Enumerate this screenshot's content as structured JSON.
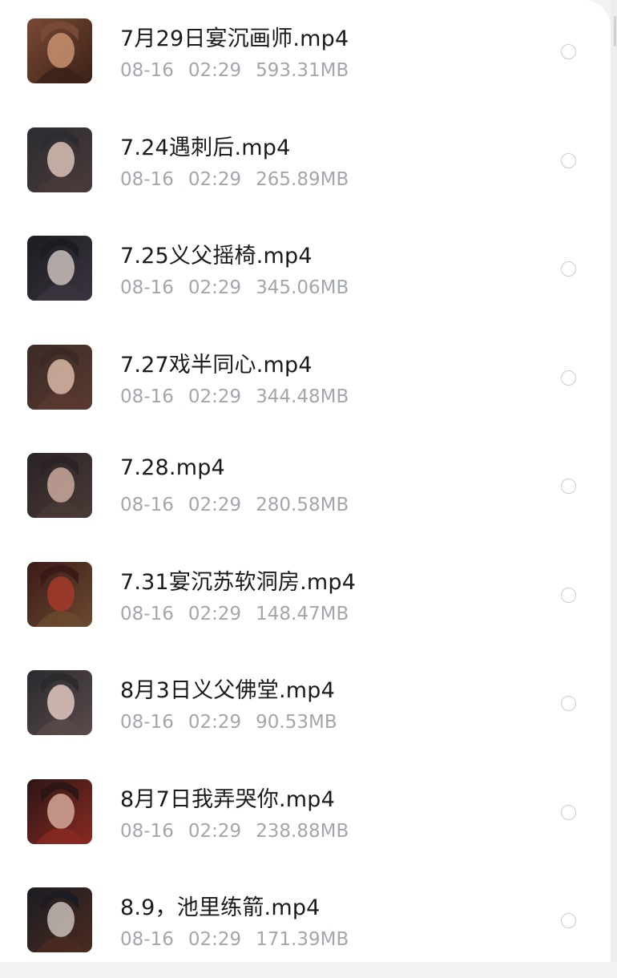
{
  "files": [
    {
      "name": "7月29日宴沉画师.mp4",
      "date": "08-16",
      "time": "02:29",
      "size": "593.31MB",
      "thumbnail": "video-thumbnail",
      "colors": [
        "#7a4a35",
        "#c89070",
        "#3a2016"
      ]
    },
    {
      "name": "7.24遇刺后.mp4",
      "date": "08-16",
      "time": "02:29",
      "size": "265.89MB",
      "thumbnail": "video-thumbnail",
      "colors": [
        "#2c2c30",
        "#d9c2b6",
        "#4a3a3a"
      ]
    },
    {
      "name": "7.25义父摇椅.mp4",
      "date": "08-16",
      "time": "02:29",
      "size": "345.06MB",
      "thumbnail": "video-thumbnail",
      "colors": [
        "#1c1c20",
        "#c9c0bc",
        "#3b3440"
      ]
    },
    {
      "name": "7.27戏半同心.mp4",
      "date": "08-16",
      "time": "02:29",
      "size": "344.48MB",
      "thumbnail": "video-thumbnail",
      "colors": [
        "#3a2a26",
        "#d8b8a8",
        "#5a3a30"
      ]
    },
    {
      "name": "7.28.mp4",
      "date": "08-16",
      "time": "02:29",
      "size": "280.58MB",
      "thumbnail": "video-thumbnail",
      "colors": [
        "#2a2226",
        "#caa99c",
        "#4a3a36"
      ]
    },
    {
      "name": "7.31宴沉苏软洞房.mp4",
      "date": "08-16",
      "time": "02:29",
      "size": "148.47MB",
      "thumbnail": "video-thumbnail",
      "colors": [
        "#3a1a16",
        "#a33a2a",
        "#6a4a30"
      ]
    },
    {
      "name": "8月3日义父佛堂.mp4",
      "date": "08-16",
      "time": "02:29",
      "size": "90.53MB",
      "thumbnail": "video-thumbnail",
      "colors": [
        "#2a2a2e",
        "#e0c8c0",
        "#5a4a4a"
      ]
    },
    {
      "name": "8月7日我弄哭你.mp4",
      "date": "08-16",
      "time": "02:29",
      "size": "238.88MB",
      "thumbnail": "video-thumbnail",
      "colors": [
        "#2a1616",
        "#d4a898",
        "#8a2a22"
      ]
    },
    {
      "name": "8.9，池里练箭.mp4",
      "date": "08-16",
      "time": "02:29",
      "size": "171.39MB",
      "thumbnail": "video-thumbnail",
      "colors": [
        "#1c1c22",
        "#c8beb8",
        "#4a2a20"
      ]
    }
  ]
}
